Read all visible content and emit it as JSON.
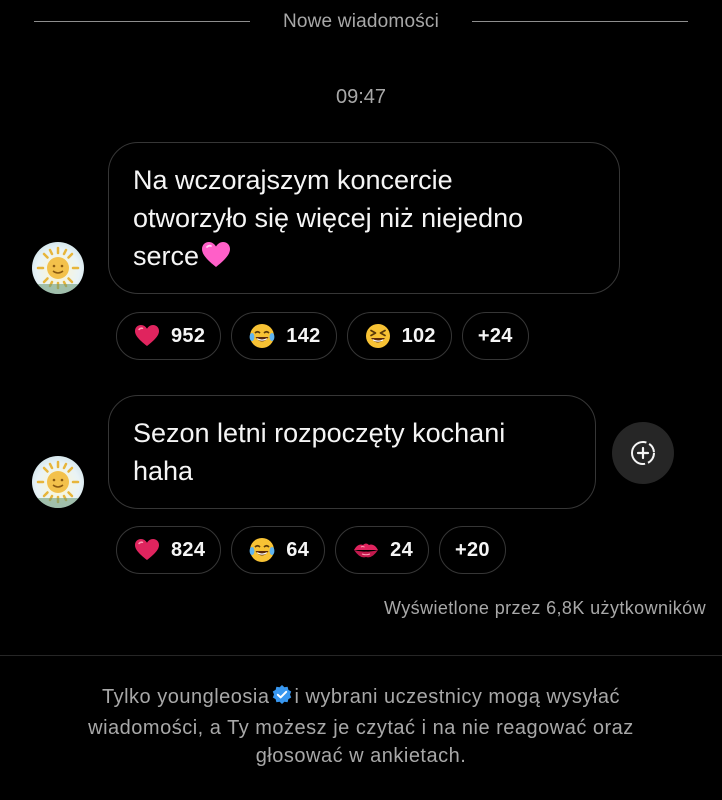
{
  "header": {
    "divider_label": "Nowe wiadomości"
  },
  "timestamp": "09:47",
  "messages": [
    {
      "lines": [
        "Na wczorajszym koncercie",
        "otworzyło się więcej niż niejedno",
        "serce"
      ],
      "trailing_emoji": "pink-heart-icon",
      "reactions": [
        {
          "icon": "red-heart-icon",
          "count": "952"
        },
        {
          "icon": "tears-of-joy-icon",
          "count": "142"
        },
        {
          "icon": "grinning-squinting-icon",
          "count": "102"
        }
      ],
      "more": "+24"
    },
    {
      "lines": [
        "Sezon letni rozpoczęty kochani",
        "haha"
      ],
      "reactions": [
        {
          "icon": "red-heart-icon",
          "count": "824"
        },
        {
          "icon": "tears-of-joy-icon",
          "count": "64"
        },
        {
          "icon": "kiss-mark-icon",
          "count": "24"
        }
      ],
      "more": "+20"
    }
  ],
  "seen_by": "Wyświetlone przez 6,8K użytkowników",
  "footer": {
    "part1": "Tylko youngleosia",
    "part2": "i wybrani uczestnicy mogą wysyłać",
    "part3": "wiadomości, a Ty możesz je czytać i na nie reagować oraz",
    "part4": "głosować w ankietach."
  },
  "colors": {
    "background": "#000000",
    "bubble_border": "#363636",
    "muted_text": "#a8a8a8",
    "verified_blue": "#3897f0",
    "heart_red": "#e0245e",
    "pink_heart": "#ff5fc8"
  }
}
